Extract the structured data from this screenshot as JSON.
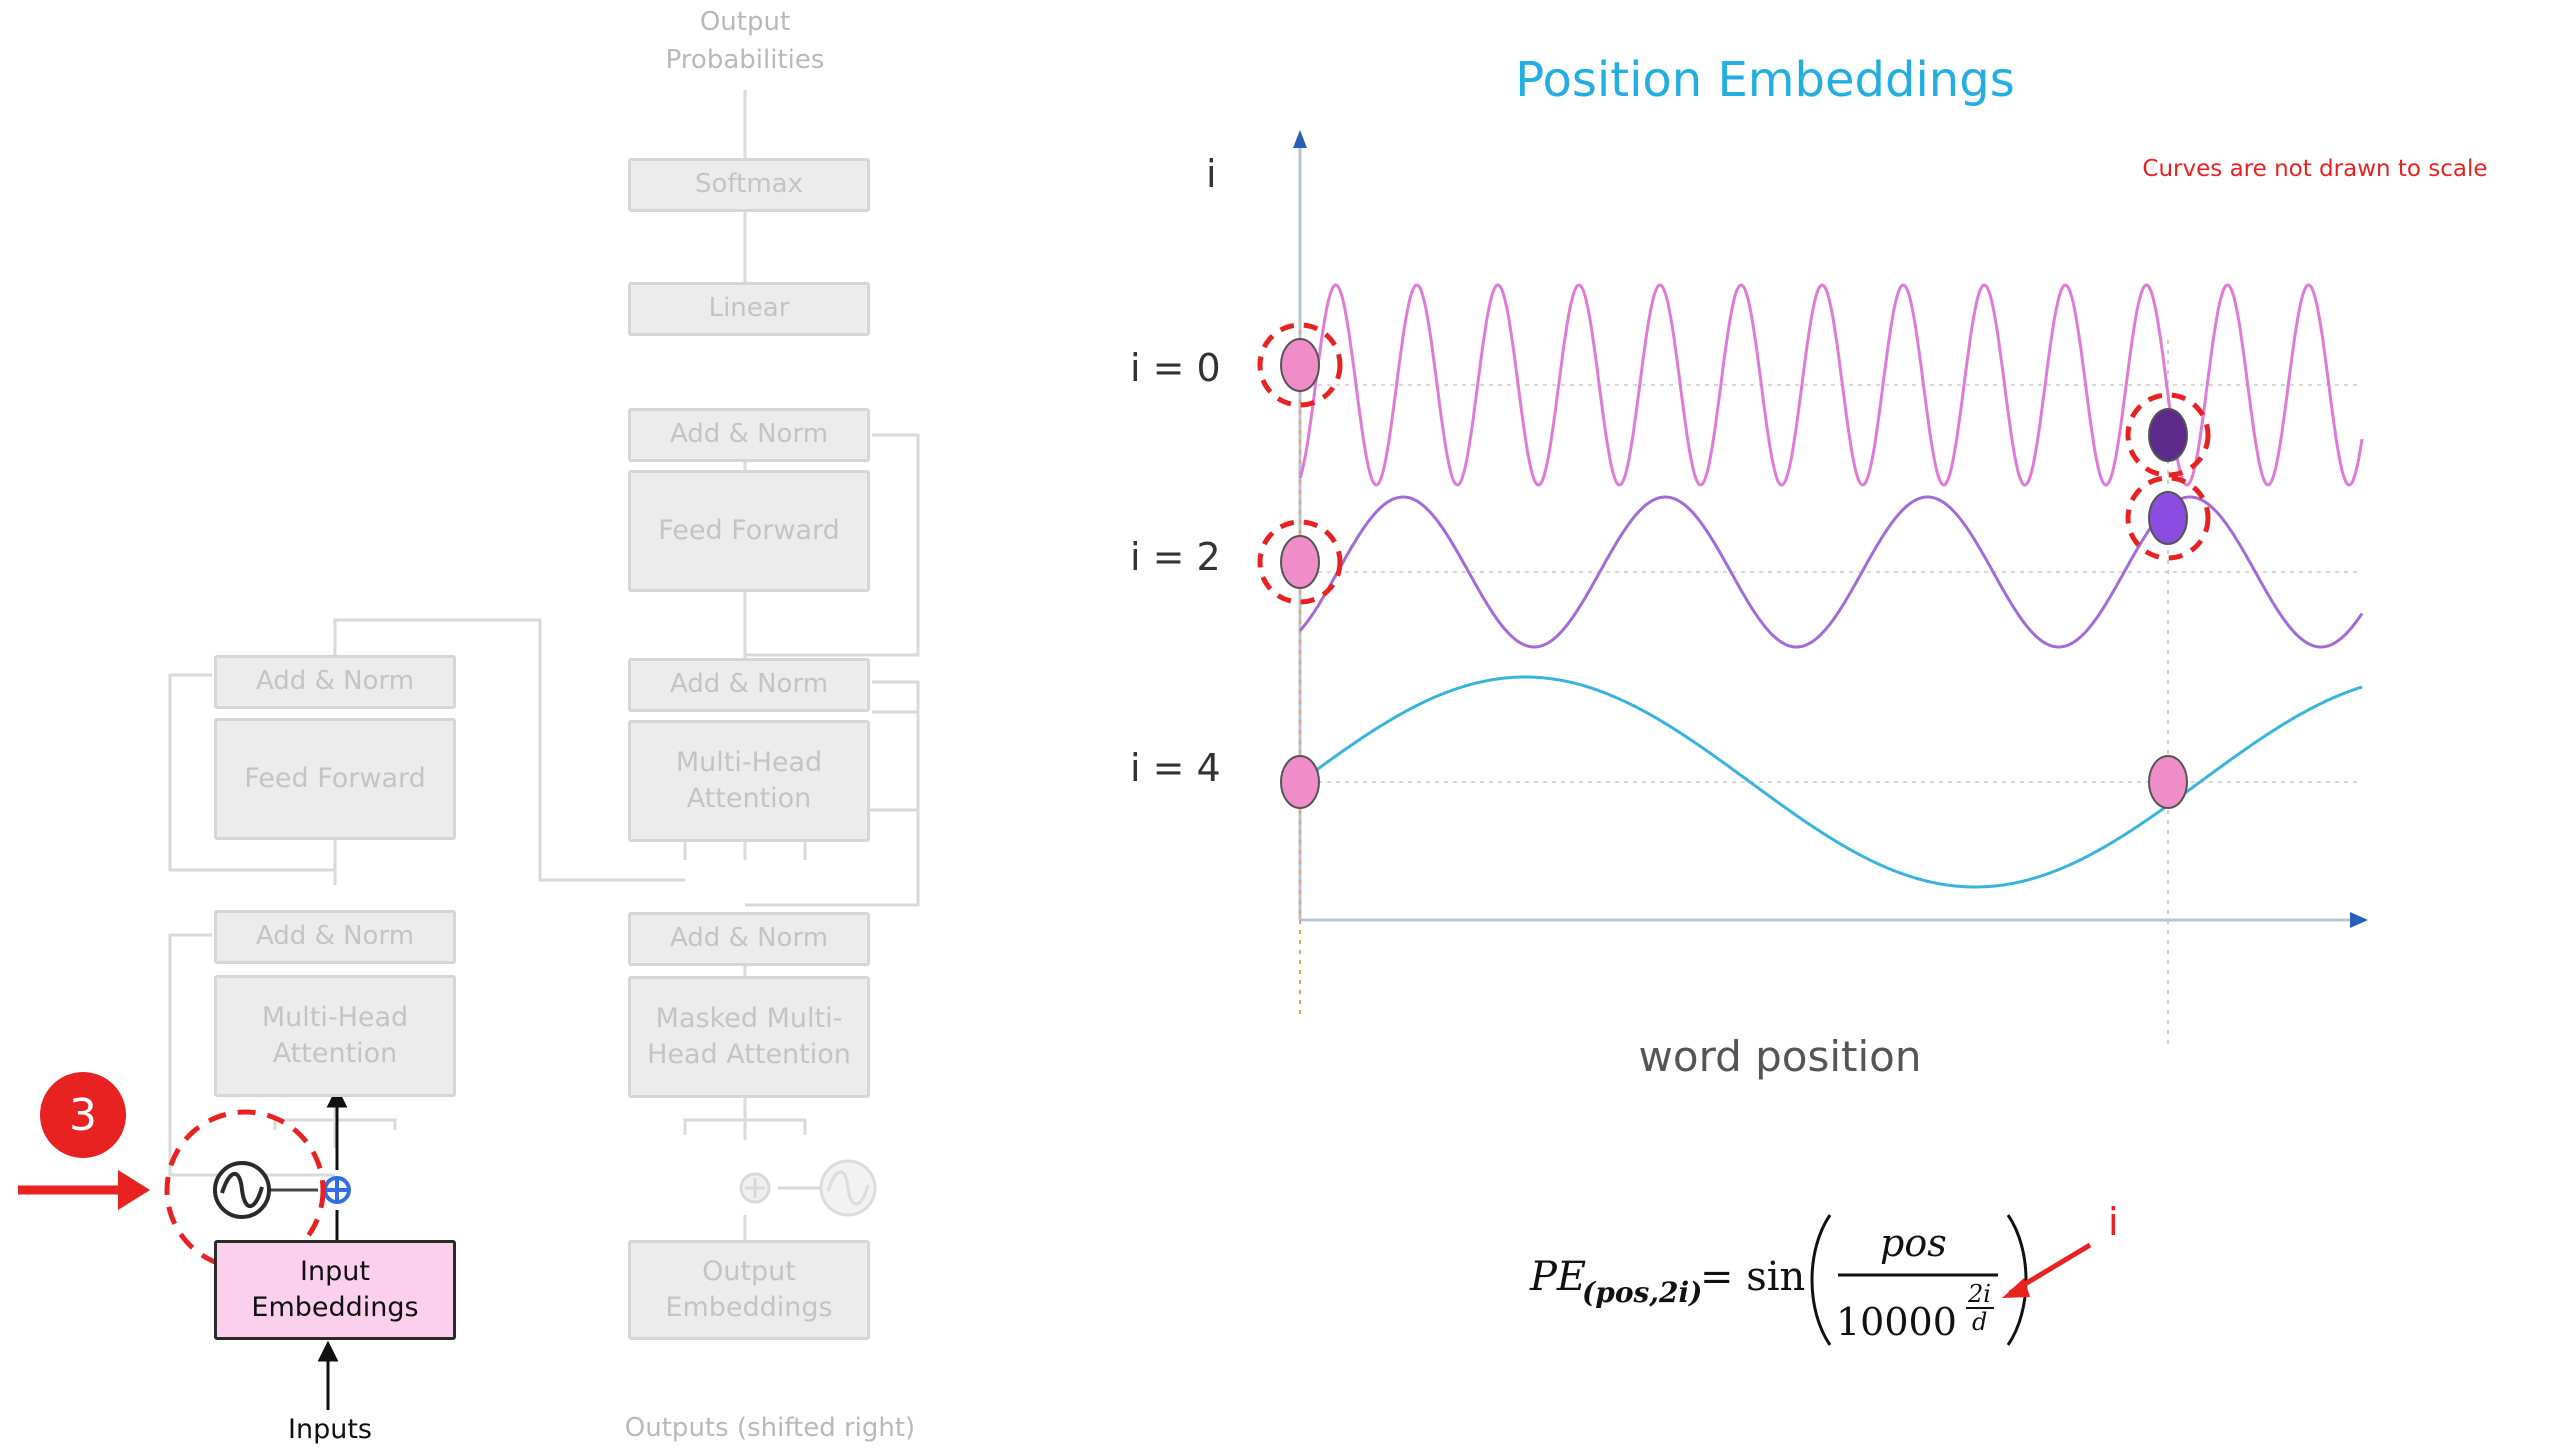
{
  "slide": {
    "title": "Position Embeddings",
    "note": "Curves are not drawn to scale",
    "step_number": "3"
  },
  "transformer": {
    "output_probabilities": "Output\nProbabilities",
    "softmax": "Softmax",
    "linear": "Linear",
    "decoder_add_norm_top": "Add & Norm",
    "decoder_feed_forward": "Feed Forward",
    "decoder_add_norm_mid": "Add & Norm",
    "decoder_multi_head_attention": "Multi-Head\nAttention",
    "decoder_add_norm_bottom": "Add & Norm",
    "decoder_masked_attention": "Masked Multi-\nHead Attention",
    "output_embeddings": "Output\nEmbeddings",
    "outputs_label": "Outputs (shifted right)",
    "encoder_add_norm_top": "Add & Norm",
    "encoder_feed_forward": "Feed Forward",
    "encoder_add_norm_bottom": "Add & Norm",
    "encoder_multi_head_attention": "Multi-Head\nAttention",
    "input_embeddings": "Input\nEmbeddings",
    "inputs_label": "Inputs"
  },
  "chart_data": {
    "type": "line",
    "title": "Position Embeddings",
    "xlabel": "word position",
    "ylabel": "i",
    "grid": false,
    "series": [
      {
        "name": "i = 0",
        "color": "#e07ad8",
        "cycles": 13.1,
        "phase": -1.2,
        "amplitude": 1.0
      },
      {
        "name": "i = 2",
        "color": "#a36ad8",
        "cycles": 4.05,
        "phase": -0.9,
        "amplitude": 1.0
      },
      {
        "name": "i = 4",
        "color": "#38b4dc",
        "cycles": 1.18,
        "phase": 0.0,
        "amplitude": 1.0
      }
    ],
    "y_labels": [
      "i = 0",
      "i = 2",
      "i = 4"
    ],
    "markers": [
      {
        "series": "i = 0",
        "position": "start",
        "color": "#f08cc8",
        "circled": true
      },
      {
        "series": "i = 2",
        "position": "start",
        "color": "#f08cc8",
        "circled": true
      },
      {
        "series": "i = 4",
        "position": "start",
        "color": "#f08cc8",
        "circled": false
      },
      {
        "series": "i = 0",
        "position": "compared",
        "color": "#5b2a8a",
        "circled": true
      },
      {
        "series": "i = 2",
        "position": "compared",
        "color": "#8a4de0",
        "circled": true
      },
      {
        "series": "i = 4",
        "position": "compared",
        "color": "#f08cc8",
        "circled": false
      }
    ]
  },
  "formula": {
    "lhs": "PE",
    "subscript": "(pos,2i)",
    "equals": "= sin",
    "numerator": "pos",
    "denominator": "10000",
    "exponent_num": "2i",
    "exponent_den": "d",
    "pointer_label": "i"
  },
  "colors": {
    "accent": "#22aee2",
    "alert": "#e82121",
    "input_embedding_fill": "#fbd0ec"
  }
}
